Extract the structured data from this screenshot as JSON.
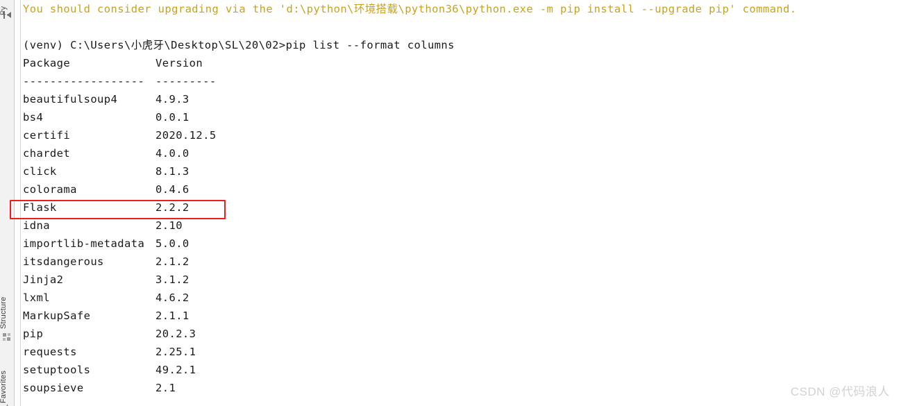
{
  "sidebar": {
    "collapse_icon": "collapse-arrow-icon",
    "items": [
      {
        "label": "Pу",
        "name": "tool-window-python-console",
        "truncated": true
      },
      {
        "label": "Structure",
        "name": "tool-window-structure",
        "icon": "structure-blocks-icon"
      },
      {
        "label": "Favorites",
        "name": "tool-window-favorites",
        "icon": "favorites-star-icon"
      }
    ]
  },
  "console": {
    "warning_line": "You should consider upgrading via the 'd:\\python\\环境搭载\\python36\\python.exe -m pip install --upgrade pip' command.",
    "warning_color": "#c8a21f",
    "prompt_line": "(venv) C:\\Users\\小虎牙\\Desktop\\SL\\20\\02>pip list --format columns",
    "header": {
      "package": "Package",
      "version": "Version"
    },
    "separator": {
      "package": "------------------",
      "version": "---------"
    },
    "packages": [
      {
        "name": "beautifulsoup4",
        "version": "4.9.3"
      },
      {
        "name": "bs4",
        "version": "0.0.1"
      },
      {
        "name": "certifi",
        "version": "2020.12.5"
      },
      {
        "name": "chardet",
        "version": "4.0.0"
      },
      {
        "name": "click",
        "version": "8.1.3"
      },
      {
        "name": "colorama",
        "version": "0.4.6"
      },
      {
        "name": "Flask",
        "version": "2.2.2"
      },
      {
        "name": "idna",
        "version": "2.10"
      },
      {
        "name": "importlib-metadata",
        "version": "5.0.0"
      },
      {
        "name": "itsdangerous",
        "version": "2.1.2"
      },
      {
        "name": "Jinja2",
        "version": "3.1.2"
      },
      {
        "name": "lxml",
        "version": "4.6.2"
      },
      {
        "name": "MarkupSafe",
        "version": "2.1.1"
      },
      {
        "name": "pip",
        "version": "20.2.3"
      },
      {
        "name": "requests",
        "version": "2.25.1"
      },
      {
        "name": "setuptools",
        "version": "49.2.1"
      },
      {
        "name": "soupsieve",
        "version": "2.1"
      }
    ],
    "highlight": {
      "package": "Flask",
      "color": "#ee1c1c"
    }
  },
  "watermark": "CSDN @代码浪人"
}
